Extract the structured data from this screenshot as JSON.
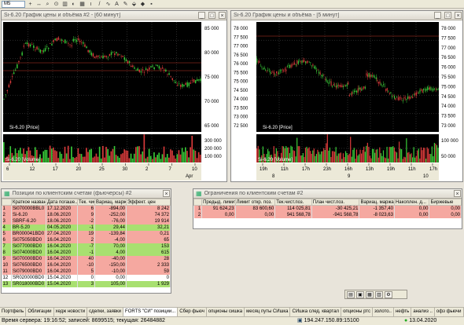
{
  "toolbar": {
    "combo": "M5",
    "buttons": [
      "+",
      "↔",
      "⌕",
      "⊙",
      "▥",
      "◐",
      "▦",
      "ı",
      "/",
      "∿",
      "A",
      "✎",
      "⬙",
      "◆",
      "▪"
    ]
  },
  "chart1": {
    "title": "Si-6.20 График цены и объёма #2 - [60 минут]",
    "price_label": "Si-6.20 [Price]",
    "volume_label": "Si-6.20 [Volume]",
    "y_ticks": [
      "85 000",
      "80 000",
      "75 000",
      "70 000",
      "65 000"
    ],
    "vol_ticks": [
      "300 000",
      "200 000",
      "100 000"
    ],
    "x_days": [
      "6",
      "12",
      "17",
      "20",
      "25",
      "30",
      "2",
      "7",
      "10"
    ],
    "x_months": [
      "",
      "Apr"
    ]
  },
  "chart2": {
    "title": "Si-6.20 График цены и объёма - [5 минут]",
    "price_label": "Si-6.20 [Price]",
    "volume_label": "Si-6.20 [Volume]",
    "y_ticks": [
      "78 000",
      "77 500",
      "77 000",
      "76 500",
      "76 000",
      "75 500",
      "75 000",
      "74 500",
      "74 000",
      "73 500",
      "73 000",
      "72 500"
    ],
    "y_ticks_right": [
      "78 000",
      "77 500",
      "77 000",
      "76 500",
      "76 000",
      "75 500",
      "75 000",
      "74 500",
      "74 000",
      "73 500",
      "73 000"
    ],
    "vol_ticks": [
      "100 000",
      "50 000"
    ],
    "x_hours": [
      "19h",
      "11h",
      "17h",
      "23h",
      "16h",
      "13h",
      "19h",
      "11h",
      "17h"
    ],
    "x_days": [
      "8",
      "9",
      "10"
    ]
  },
  "positions": {
    "title": "Позиции по клиентским счетам (фьючерсы) #2",
    "columns": [
      "",
      "Краткое название",
      "Дата погаше...",
      "Тек. чист.",
      "Вариац. маржа",
      "Эффект. цен"
    ],
    "rows": [
      {
        "n": "1",
        "name": "Si070000BBL0",
        "date": "17.12.2020",
        "pos": "6",
        "var": "-894,00",
        "eff": "8 242",
        "style": "red"
      },
      {
        "n": "2",
        "name": "Si-6.20",
        "date": "18.06.2020",
        "pos": "9",
        "var": "-252,00",
        "eff": "74 372",
        "style": "red"
      },
      {
        "n": "3",
        "name": "SBRF-6.20",
        "date": "18.06.2020",
        "pos": "-2",
        "var": "-76,00",
        "eff": "19 914",
        "style": "red"
      },
      {
        "n": "4",
        "name": "BR-5.20",
        "date": "04.05.2020",
        "pos": "-1",
        "var": "29,44",
        "eff": "32,21",
        "style": "green"
      },
      {
        "n": "5",
        "name": "BR000041BD0",
        "date": "27.04.2020",
        "pos": "19",
        "var": "-139,84",
        "eff": "0,21",
        "style": "red"
      },
      {
        "n": "6",
        "name": "Si075050BD0",
        "date": "16.04.2020",
        "pos": "2",
        "var": "-4,00",
        "eff": "65",
        "style": "red"
      },
      {
        "n": "7",
        "name": "Si077000BD0",
        "date": "16.04.2020",
        "pos": "-7",
        "var": "70,00",
        "eff": "153",
        "style": "green"
      },
      {
        "n": "8",
        "name": "Si074000BD0",
        "date": "16.04.2020",
        "pos": "-1",
        "var": "4,00",
        "eff": "615",
        "style": "green"
      },
      {
        "n": "9",
        "name": "Si070000BD0",
        "date": "16.04.2020",
        "pos": "40",
        "var": "-40,00",
        "eff": "28",
        "style": "red"
      },
      {
        "n": "10",
        "name": "Si076500BD0",
        "date": "16.04.2020",
        "pos": "-10",
        "var": "-150,00",
        "eff": "2 333",
        "style": "red"
      },
      {
        "n": "11",
        "name": "Si079000BD0",
        "date": "16.04.2020",
        "pos": "5",
        "var": "-10,00",
        "eff": "59",
        "style": "red"
      },
      {
        "n": "12",
        "name": "SR020000BD0",
        "date": "15.04.2020",
        "pos": "0",
        "var": "0,00",
        "eff": "0",
        "style": "white"
      },
      {
        "n": "13",
        "name": "SR018000BD0",
        "date": "15.04.2020",
        "pos": "3",
        "var": "105,00",
        "eff": "1 929",
        "style": "green"
      }
    ]
  },
  "limits": {
    "title": "Ограничения по клиентским счетам #2",
    "columns": [
      "",
      "Предыд. лимит",
      "Лимит откр. поз.",
      "Тек.чист.поз.",
      "План чист.поз.",
      "Вариац. маржа",
      "Накоплен. д...",
      "Биржевые"
    ],
    "rows": [
      {
        "n": "1",
        "prev": "91 624,23",
        "lim": "83 600,60",
        "cur": "114 025,81",
        "plan": "-30 425,21",
        "var": "-1 357,40",
        "acc": "0,00",
        "fee": "0,00"
      },
      {
        "n": "2",
        "prev": "0,00",
        "lim": "0,00",
        "cur": "941 568,78",
        "plan": "-941 568,78",
        "var": "-8 023,63",
        "acc": "0,00",
        "fee": "0,00"
      }
    ]
  },
  "taskbar": [
    "Портфель",
    "Облигации",
    "хедж новости",
    "сделки, заявки",
    "FORTS \"СИ\" позиции...",
    "Сбер фьюч",
    "опционы сишка",
    "месяц путы СИшка",
    "СИшка след. квартал",
    "опционы ртс",
    "золото..",
    "нефть",
    "анализ ..",
    "офз фьючи"
  ],
  "status": {
    "server_time": "Время сервера: 19:16:52; записей: 8699515; текущая: 26484882",
    "ip": "194.247.150.89:15100",
    "date": "13.04.2020"
  }
}
